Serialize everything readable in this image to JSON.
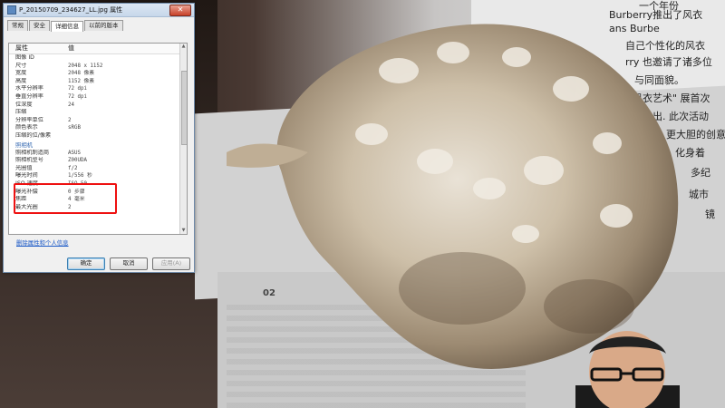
{
  "window": {
    "title": "P_20150709_234627_LL.jpg 属性",
    "close_glyph": "✕"
  },
  "tabs": [
    {
      "label": "常规"
    },
    {
      "label": "安全"
    },
    {
      "label": "详细信息",
      "active": true
    },
    {
      "label": "以前的版本"
    }
  ],
  "table": {
    "header": {
      "key": "属性",
      "value": "值"
    },
    "rows_before": [
      {
        "k": "图像 ID",
        "v": ""
      },
      {
        "k": "尺寸",
        "v": "2048 x 1152"
      },
      {
        "k": "宽度",
        "v": "2048 像素"
      },
      {
        "k": "高度",
        "v": "1152 像素"
      },
      {
        "k": "水平分辨率",
        "v": "72 dpi"
      },
      {
        "k": "垂直分辨率",
        "v": "72 dpi"
      },
      {
        "k": "位深度",
        "v": "24"
      },
      {
        "k": "压缩",
        "v": ""
      },
      {
        "k": "分辨率单位",
        "v": "2"
      },
      {
        "k": "颜色表示",
        "v": "sRGB"
      },
      {
        "k": "压缩的位/像素",
        "v": ""
      }
    ],
    "section_camera": "照相机",
    "rows_after": [
      {
        "k": "照相机制造商",
        "v": "ASUS"
      },
      {
        "k": "照相机型号",
        "v": "Z00UDA"
      },
      {
        "k": "光圈值",
        "v": "f/2"
      },
      {
        "k": "曝光时间",
        "v": "1/556 秒"
      },
      {
        "k": "ISO 速度",
        "v": "ISO-50"
      },
      {
        "k": "曝光补偿",
        "v": "0 步骤"
      },
      {
        "k": "焦距",
        "v": "4 毫米"
      },
      {
        "k": "最大光圈",
        "v": "2"
      }
    ]
  },
  "link_text": "删除属性和个人信息",
  "buttons": {
    "ok": "确定",
    "cancel": "取消",
    "apply": "应用(A)"
  },
  "background": {
    "page_number": "02",
    "right_text_lines": [
      "一个年份",
      "Burberry推出了风衣",
      "ans Burbe",
      "自己个性化的风衣",
      "rry 也邀请了诸多位",
      "与同面貌。",
      "风衣艺术\" 展首次",
      "出. 此次活动",
      "更大胆的创意",
      "化身着",
      "多纪",
      "城市",
      "镜"
    ]
  },
  "colors": {
    "highlight": "#e11111",
    "link": "#1b59c7",
    "accent": "#3a6db3"
  }
}
